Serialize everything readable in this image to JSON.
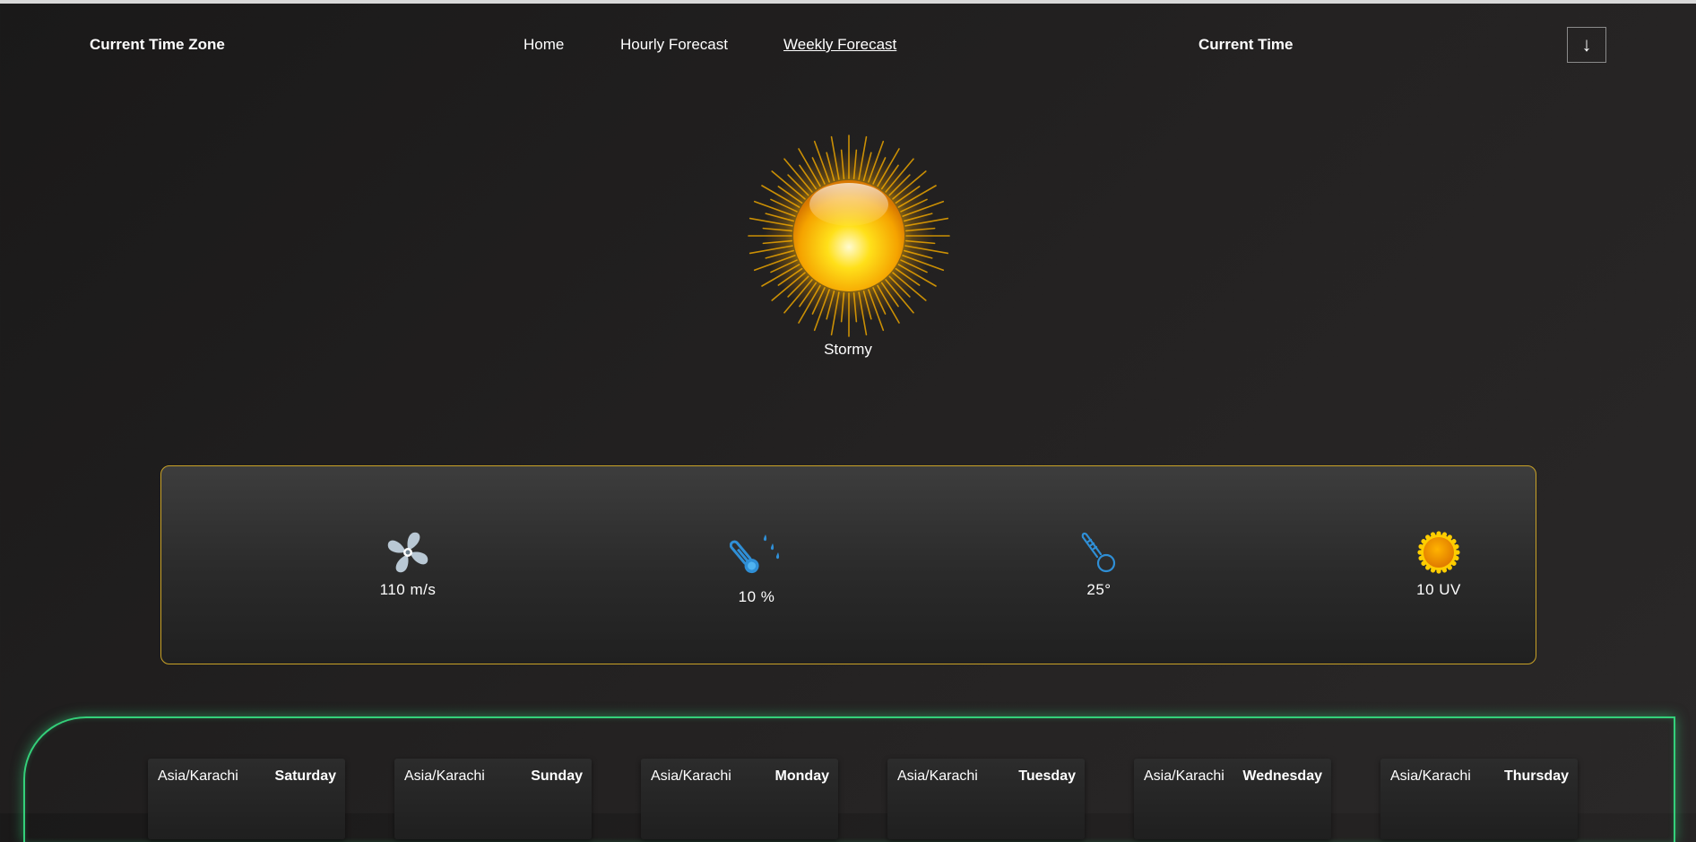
{
  "header": {
    "brand": "Current Time Zone",
    "links": [
      {
        "label": "Home",
        "active": false
      },
      {
        "label": "Hourly Forecast",
        "active": false
      },
      {
        "label": "Weekly Forecast",
        "active": true
      }
    ],
    "current_time_label": "Current Time",
    "arrow_icon": "↓"
  },
  "hero": {
    "icon": "sun-icon",
    "condition": "Stormy"
  },
  "stats": {
    "wind": {
      "icon": "fan-icon",
      "value": "110 m/s"
    },
    "humidity": {
      "icon": "humidity-thermometer-icon",
      "value": "10 %"
    },
    "temperature": {
      "icon": "thermometer-icon",
      "value": "25°"
    },
    "uv": {
      "icon": "sun-uv-icon",
      "value": "10 UV"
    }
  },
  "forecast": [
    {
      "timezone": "Asia/Karachi",
      "day": "Saturday"
    },
    {
      "timezone": "Asia/Karachi",
      "day": "Sunday"
    },
    {
      "timezone": "Asia/Karachi",
      "day": "Monday"
    },
    {
      "timezone": "Asia/Karachi",
      "day": "Tuesday"
    },
    {
      "timezone": "Asia/Karachi",
      "day": "Wednesday"
    },
    {
      "timezone": "Asia/Karachi",
      "day": "Thursday"
    }
  ],
  "colors": {
    "card_border": "#c9a227",
    "panel_glow": "#34d07a",
    "icon_blue": "#2f8fd6"
  }
}
